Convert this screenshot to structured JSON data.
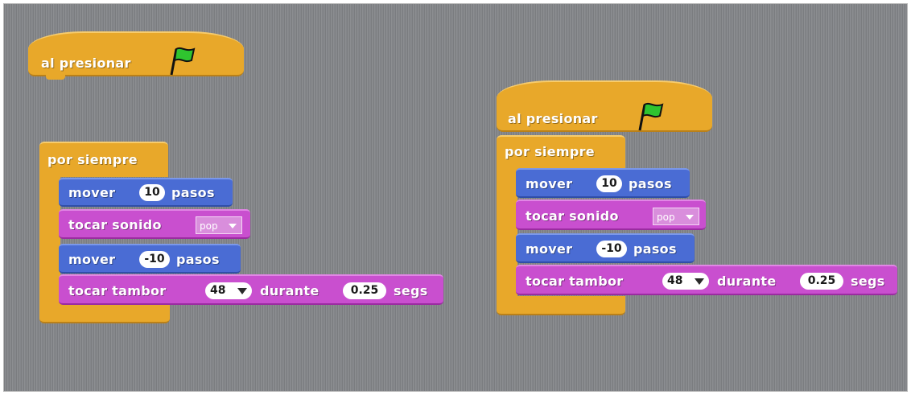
{
  "scripts": [
    {
      "hat_label": "al presionar",
      "forever_label": "por siempre",
      "move1": {
        "prefix": "mover",
        "value": "10",
        "suffix": "pasos"
      },
      "sound": {
        "prefix": "tocar sonido",
        "value": "pop"
      },
      "move2": {
        "prefix": "mover",
        "value": "-10",
        "suffix": "pasos"
      },
      "drum": {
        "prefix": "tocar tambor",
        "drum": "48",
        "middle": "durante",
        "beats": "0.25",
        "suffix": "segs"
      }
    },
    {
      "hat_label": "al presionar",
      "forever_label": "por siempre",
      "move1": {
        "prefix": "mover",
        "value": "10",
        "suffix": "pasos"
      },
      "sound": {
        "prefix": "tocar sonido",
        "value": "pop"
      },
      "move2": {
        "prefix": "mover",
        "value": "-10",
        "suffix": "pasos"
      },
      "drum": {
        "prefix": "tocar tambor",
        "drum": "48",
        "middle": "durante",
        "beats": "0.25",
        "suffix": "segs"
      }
    }
  ],
  "colors": {
    "control": "#e8a82a",
    "motion": "#4a6cd4",
    "sound": "#c94fcf",
    "flag": "#2fc42f",
    "workspace": "#85878a"
  },
  "icons": {
    "hat_icon": "green-flag-icon",
    "dropdown_icon": "dropdown-arrow-icon"
  }
}
